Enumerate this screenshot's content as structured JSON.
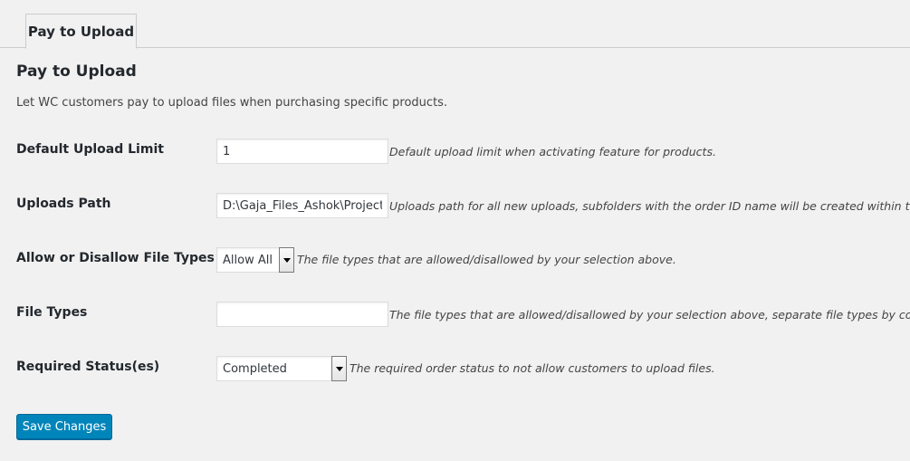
{
  "tab": {
    "label": "Pay to Upload"
  },
  "page": {
    "title": "Pay to Upload",
    "intro": "Let WC customers pay to upload files when purchasing specific products."
  },
  "fields": {
    "upload_limit": {
      "label": "Default Upload Limit",
      "value": "1",
      "description": "Default upload limit when activating feature for products."
    },
    "uploads_path": {
      "label": "Uploads Path",
      "value": "D:\\Gaja_Files_Ashok\\Project",
      "description": "Uploads path for all new uploads, subfolders with the order ID name will be created within this."
    },
    "file_type_mode": {
      "label": "Allow or Disallow File Types",
      "selected": "Allow All",
      "description": "The file types that are allowed/disallowed by your selection above."
    },
    "file_types": {
      "label": "File Types",
      "value": "",
      "description": "The file types that are allowed/disallowed by your selection above, separate file types by commas."
    },
    "required_status": {
      "label": "Required Status(es)",
      "selected": "Completed",
      "description": "The required order status to not allow customers to upload files."
    }
  },
  "actions": {
    "save_label": "Save Changes"
  },
  "colors": {
    "primary_button": "#0085ba",
    "background": "#f1f1f1"
  },
  "icons": {
    "dropdown": "chevron-down-icon"
  }
}
